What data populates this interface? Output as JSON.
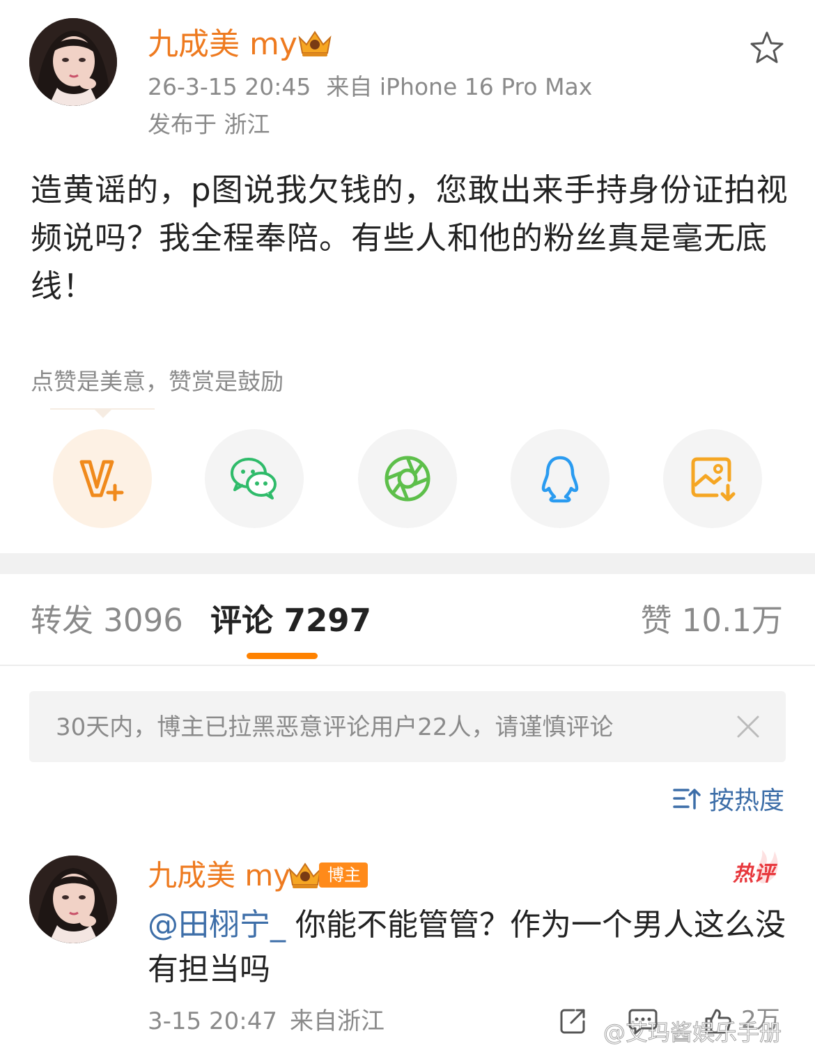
{
  "post": {
    "author_name": "九成美 my",
    "timestamp": "26-3-15 20:45",
    "source": "来自 iPhone 16 Pro Max",
    "location": "发布于 浙江",
    "body": "造黄谣的，p图说我欠钱的，您敢出来手持身份证拍视频说吗？我全程奉陪。有些人和他的粉丝真是毫无底线！",
    "reward_hint": "点赞是美意，赞赏是鼓励"
  },
  "share_options": [
    {
      "icon": "v-plus-icon"
    },
    {
      "icon": "wechat-icon"
    },
    {
      "icon": "moments-icon"
    },
    {
      "icon": "qq-icon"
    },
    {
      "icon": "save-image-icon"
    }
  ],
  "tabs": {
    "repost": "转发 3096",
    "comments": "评论 7297",
    "likes": "赞 10.1万"
  },
  "notice": {
    "text": "30天内，博主已拉黑恶意评论用户22人，请谨慎评论"
  },
  "sort": {
    "label": "按热度"
  },
  "comment": {
    "author_name": "九成美 my",
    "badge": "博主",
    "hot_label": "热评",
    "mention": "@田栩宁_",
    "text": " 你能不能管管？作为一个男人这么没有担当吗",
    "timestamp": "3-15 20:47",
    "source": "来自浙江",
    "likes": "2万"
  },
  "watermark": "@艾玛酱娱乐手册",
  "colors": {
    "accent": "#ff8200",
    "name": "#ee7a1f",
    "link": "#3d6ea8",
    "muted": "#8a8a8a"
  }
}
